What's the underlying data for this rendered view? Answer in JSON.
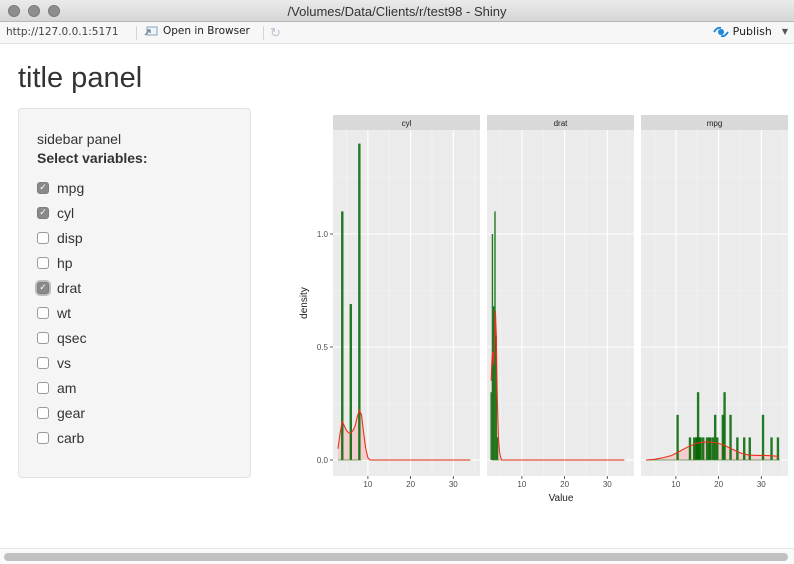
{
  "window": {
    "title": "/Volumes/Data/Clients/r/test98 - Shiny"
  },
  "toolbar": {
    "url": "http://127.0.0.1:5171",
    "open_in_browser": "Open in Browser",
    "publish": "Publish",
    "icons": {
      "open_browser": "open-browser-icon",
      "refresh": "refresh-icon",
      "publish": "publish-icon",
      "dropdown": "chevron-down-icon"
    }
  },
  "page": {
    "title": "title panel"
  },
  "sidebar": {
    "label": "sidebar panel",
    "heading": "Select variables:",
    "options": [
      {
        "label": "mpg",
        "checked": true
      },
      {
        "label": "cyl",
        "checked": true
      },
      {
        "label": "disp",
        "checked": false
      },
      {
        "label": "hp",
        "checked": false
      },
      {
        "label": "drat",
        "checked": true,
        "focused": true
      },
      {
        "label": "wt",
        "checked": false
      },
      {
        "label": "qsec",
        "checked": false
      },
      {
        "label": "vs",
        "checked": false
      },
      {
        "label": "am",
        "checked": false
      },
      {
        "label": "gear",
        "checked": false
      },
      {
        "label": "carb",
        "checked": false
      }
    ]
  },
  "chart_data": {
    "type": "bar",
    "subtype": "faceted histogram with density overlay",
    "xlabel": "Value",
    "ylabel": "density",
    "xlim": [
      2,
      35
    ],
    "ylim": [
      -0.05,
      1.45
    ],
    "x_ticks": [
      10,
      20,
      30
    ],
    "y_ticks": [
      0.0,
      0.5,
      1.0
    ],
    "y_tick_labels": [
      "0.0",
      "0.5",
      "1.0"
    ],
    "grid": true,
    "colors": {
      "bar": "#006400",
      "density_line": "#e8311a",
      "density_fill": "#f4c6c6",
      "panel_bg": "#ebebeb",
      "strip_bg": "#d9d9d9"
    },
    "facets": [
      {
        "name": "cyl",
        "bars": [
          {
            "x": 4,
            "density": 1.1
          },
          {
            "x": 6,
            "density": 0.69
          },
          {
            "x": 8,
            "density": 1.4
          }
        ],
        "density_curve": [
          [
            3.0,
            0.05
          ],
          [
            3.5,
            0.12
          ],
          [
            4.0,
            0.17
          ],
          [
            4.5,
            0.15
          ],
          [
            5.0,
            0.13
          ],
          [
            5.5,
            0.12
          ],
          [
            6.0,
            0.12
          ],
          [
            6.5,
            0.13
          ],
          [
            7.0,
            0.15
          ],
          [
            7.5,
            0.19
          ],
          [
            8.0,
            0.22
          ],
          [
            8.5,
            0.2
          ],
          [
            9.0,
            0.12
          ],
          [
            9.5,
            0.05
          ],
          [
            10.0,
            0.01
          ],
          [
            10.5,
            0.0
          ],
          [
            34,
            0.0
          ]
        ]
      },
      {
        "name": "drat",
        "bars": [
          {
            "x": 2.8,
            "density": 0.3
          },
          {
            "x": 3.1,
            "density": 1.0
          },
          {
            "x": 3.4,
            "density": 0.68
          },
          {
            "x": 3.7,
            "density": 1.1
          },
          {
            "x": 4.0,
            "density": 0.55
          },
          {
            "x": 4.3,
            "density": 0.1
          }
        ],
        "density_curve": [
          [
            2.8,
            0.35
          ],
          [
            3.0,
            0.45
          ],
          [
            3.2,
            0.48
          ],
          [
            3.4,
            0.42
          ],
          [
            3.6,
            0.55
          ],
          [
            3.8,
            0.66
          ],
          [
            4.0,
            0.55
          ],
          [
            4.2,
            0.3
          ],
          [
            4.5,
            0.1
          ],
          [
            4.8,
            0.03
          ],
          [
            5.2,
            0.0
          ],
          [
            34,
            0.0
          ]
        ]
      },
      {
        "name": "mpg",
        "bars": [
          {
            "x": 10.4,
            "density": 0.2
          },
          {
            "x": 13.3,
            "density": 0.1
          },
          {
            "x": 14.3,
            "density": 0.1
          },
          {
            "x": 14.7,
            "density": 0.1
          },
          {
            "x": 15.0,
            "density": 0.1
          },
          {
            "x": 15.2,
            "density": 0.3
          },
          {
            "x": 15.5,
            "density": 0.1
          },
          {
            "x": 15.8,
            "density": 0.1
          },
          {
            "x": 16.4,
            "density": 0.1
          },
          {
            "x": 17.3,
            "density": 0.1
          },
          {
            "x": 17.8,
            "density": 0.1
          },
          {
            "x": 18.1,
            "density": 0.1
          },
          {
            "x": 18.7,
            "density": 0.1
          },
          {
            "x": 19.2,
            "density": 0.2
          },
          {
            "x": 19.7,
            "density": 0.1
          },
          {
            "x": 21.0,
            "density": 0.2
          },
          {
            "x": 21.4,
            "density": 0.3
          },
          {
            "x": 22.8,
            "density": 0.2
          },
          {
            "x": 24.4,
            "density": 0.1
          },
          {
            "x": 26.0,
            "density": 0.1
          },
          {
            "x": 27.3,
            "density": 0.1
          },
          {
            "x": 30.4,
            "density": 0.2
          },
          {
            "x": 32.4,
            "density": 0.1
          },
          {
            "x": 33.9,
            "density": 0.1
          }
        ],
        "density_curve": [
          [
            3,
            0.0
          ],
          [
            5,
            0.003
          ],
          [
            7,
            0.01
          ],
          [
            9,
            0.02
          ],
          [
            11,
            0.04
          ],
          [
            13,
            0.06
          ],
          [
            15,
            0.075
          ],
          [
            17,
            0.08
          ],
          [
            19,
            0.078
          ],
          [
            21,
            0.068
          ],
          [
            23,
            0.05
          ],
          [
            25,
            0.032
          ],
          [
            27,
            0.022
          ],
          [
            29,
            0.02
          ],
          [
            31,
            0.02
          ],
          [
            33,
            0.018
          ],
          [
            34,
            0.016
          ]
        ]
      }
    ]
  },
  "scrollbar": {
    "horizontal": true
  }
}
